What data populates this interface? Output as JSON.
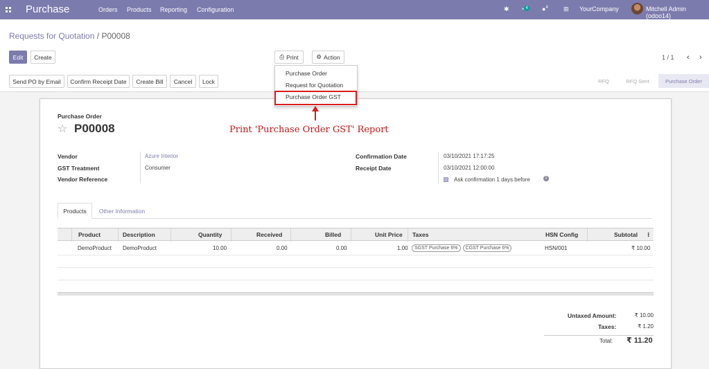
{
  "nav": {
    "app_title": "Purchase",
    "menu": [
      "Orders",
      "Products",
      "Reporting",
      "Configuration"
    ],
    "activity_count": "4",
    "chat_count": "4",
    "company": "YourCompany",
    "user": "Mitchell Admin (odoo14)"
  },
  "breadcrumb": {
    "parent": "Requests for Quotation",
    "separator": "/",
    "current": "P00008"
  },
  "toolbar": {
    "edit": "Edit",
    "create": "Create",
    "print": "Print",
    "action": "Action"
  },
  "pager": {
    "value": "1 / 1",
    "prev": "‹",
    "next": "›"
  },
  "actions": [
    "Send PO by Email",
    "Confirm Receipt Date",
    "Create Bill",
    "Cancel",
    "Lock"
  ],
  "statusbar": {
    "steps": [
      "RFQ",
      "RFQ Sent",
      "Purchase Order"
    ],
    "active": "Purchase Order"
  },
  "print_menu": {
    "items": [
      "Purchase Order",
      "Request for Quotation",
      "Purchase Order GST"
    ]
  },
  "annotation": "Print 'Purchase Order GST' Report",
  "form": {
    "doc_kind": "Purchase Order",
    "doc_name": "P00008",
    "fields_left": [
      {
        "label": "Vendor",
        "value": "Azure Interior"
      },
      {
        "label": "GST Treatment",
        "value": "Consumer"
      },
      {
        "label": "Vendor Reference",
        "value": ""
      }
    ],
    "fields_right": [
      {
        "label": "Confirmation Date",
        "value": "03/10/2021 17:17:25"
      },
      {
        "label": "Receipt Date",
        "value": "03/10/2021 12:00:00"
      }
    ],
    "ask_confirmation": {
      "prefix": "Ask confirmation",
      "days": "1",
      "suffix": "days before",
      "checked": true
    }
  },
  "tabs": [
    "Products",
    "Other Information"
  ],
  "table": {
    "headers": [
      "Product",
      "Description",
      "Quantity",
      "Received",
      "Billed",
      "Unit Price",
      "Taxes",
      "HSN Config",
      "Subtotal"
    ],
    "rows": [
      {
        "product": "DemoProduct",
        "description": "DemoProduct",
        "quantity": "10.00",
        "received": "0.00",
        "billed": "0.00",
        "unit_price": "1.00",
        "taxes": [
          "SGST Purchase 6%",
          "CGST Purchase 6%"
        ],
        "hsn": "HSN/001",
        "subtotal": "₹ 10.00"
      }
    ]
  },
  "totals": {
    "untaxed_label": "Untaxed Amount:",
    "untaxed": "₹ 10.00",
    "taxes_label": "Taxes:",
    "taxes": "₹ 1.20",
    "total_label": "Total:",
    "total": "₹ 11.20"
  },
  "colors": {
    "brand": "#7c7bad",
    "annotation": "#d91c1c"
  }
}
